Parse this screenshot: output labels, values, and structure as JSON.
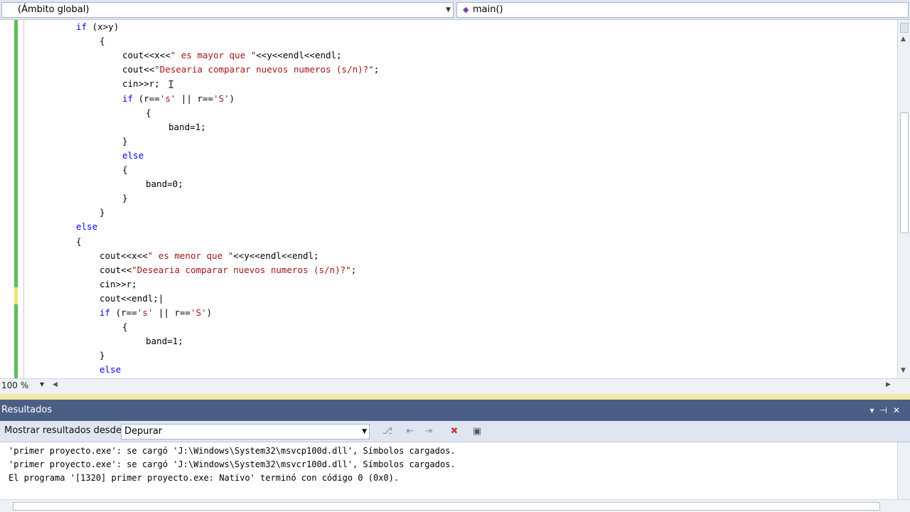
{
  "navbar": {
    "scope": "(Ámbito global)",
    "member": "main()"
  },
  "editor": {
    "lines": [
      [
        {
          "t": "if",
          "c": "kw"
        },
        {
          "t": " (x>y)"
        }
      ],
      [
        {
          "t": "{"
        }
      ],
      [
        {
          "t": "cout<<x<<"
        },
        {
          "t": "\" es mayor que \"",
          "c": "str"
        },
        {
          "t": "<<y<<endl<<endl;"
        }
      ],
      [
        {
          "t": "cout<<"
        },
        {
          "t": "\"Desearia comparar nuevos numeros (s/n)?\"",
          "c": "str"
        },
        {
          "t": ";"
        }
      ],
      [
        {
          "t": "cin>>r;"
        }
      ],
      [
        {
          "t": "if",
          "c": "kw"
        },
        {
          "t": " (r=="
        },
        {
          "t": "'s'",
          "c": "str"
        },
        {
          "t": " || r=="
        },
        {
          "t": "'S'",
          "c": "str"
        },
        {
          "t": ")"
        }
      ],
      [
        {
          "t": "{"
        }
      ],
      [
        {
          "t": "band=1;"
        }
      ],
      [
        {
          "t": "}"
        }
      ],
      [
        {
          "t": "else",
          "c": "kw"
        }
      ],
      [
        {
          "t": "{"
        }
      ],
      [
        {
          "t": "band=0;"
        }
      ],
      [
        {
          "t": "}"
        }
      ],
      [
        {
          "t": "}"
        }
      ],
      [
        {
          "t": "else",
          "c": "kw"
        }
      ],
      [
        {
          "t": "{"
        }
      ],
      [
        {
          "t": "cout<<x<<"
        },
        {
          "t": "\" es menor que \"",
          "c": "str"
        },
        {
          "t": "<<y<<endl<<endl;"
        }
      ],
      [
        {
          "t": "cout<<"
        },
        {
          "t": "\"Desearia comparar nuevos numeros (s/n)?\"",
          "c": "str"
        },
        {
          "t": ";"
        }
      ],
      [
        {
          "t": "cin>>r;"
        }
      ],
      [
        {
          "t": "cout<<endl;|"
        }
      ],
      [
        {
          "t": "if",
          "c": "kw"
        },
        {
          "t": " (r=="
        },
        {
          "t": "'s'",
          "c": "str"
        },
        {
          "t": " || r=="
        },
        {
          "t": "'S'",
          "c": "str"
        },
        {
          "t": ")"
        }
      ],
      [
        {
          "t": "{"
        }
      ],
      [
        {
          "t": "band=1;"
        }
      ],
      [
        {
          "t": "}"
        }
      ],
      [
        {
          "t": "else",
          "c": "kw"
        }
      ]
    ]
  },
  "zoom": "100 %",
  "results": {
    "title": "Resultados",
    "show_from_label": "Mostrar resultados desde:",
    "show_from_value": "Depurar",
    "lines": [
      "'primer proyecto.exe': se cargó 'J:\\Windows\\System32\\msvcp100d.dll', Símbolos cargados.",
      "'primer proyecto.exe': se cargó 'J:\\Windows\\System32\\msvcr100d.dll', Símbolos cargados.",
      "El programa '[1320] primer proyecto.exe: Nativo' terminó con código 0 (0x0)."
    ]
  }
}
